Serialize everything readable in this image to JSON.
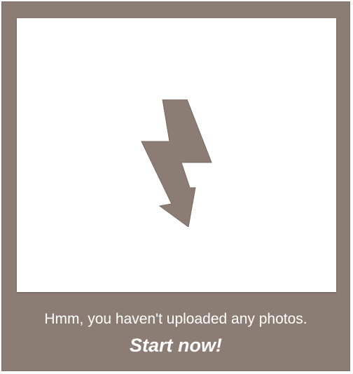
{
  "empty_state": {
    "icon": "lightning-arrow-icon",
    "message": "Hmm, you haven't uploaded any photos.",
    "cta_label": "Start now!"
  },
  "colors": {
    "frame": "#8c7d74",
    "photo_area": "#ffffff",
    "icon": "#8c7d74",
    "text": "#ffffff"
  }
}
